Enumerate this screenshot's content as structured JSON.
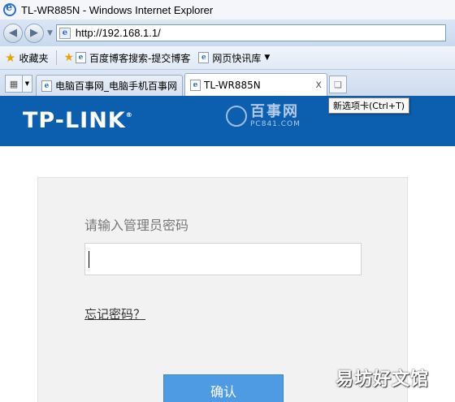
{
  "window": {
    "title": "TL-WR885N - Windows Internet Explorer"
  },
  "navigation": {
    "back_icon": "back-arrow-icon",
    "forward_icon": "forward-arrow-icon",
    "address": "http://192.168.1.1/"
  },
  "favorites": {
    "label": "收藏夹",
    "items": [
      {
        "label": "百度博客搜索-提交博客"
      },
      {
        "label": "网页快讯库"
      }
    ]
  },
  "tabs": {
    "items": [
      {
        "label": "电脑百事网_电脑手机百事网"
      },
      {
        "label": "TL-WR885N",
        "active": true
      }
    ],
    "close_glyph": "x",
    "new_tab_tooltip": "新选项卡(Ctrl+T)"
  },
  "page": {
    "brand": "TP-LINK",
    "brand_mark": "®",
    "watermark_big": "百事网",
    "watermark_small": "PC841.COM",
    "prompt": "请输入管理员密码",
    "password_value": "",
    "forgot_link": "忘记密码？",
    "confirm_button": "确认",
    "corner_watermark": "易坊好文馆"
  },
  "colors": {
    "header_blue": "#0c5eaf",
    "button_blue": "#4e9ae3"
  }
}
